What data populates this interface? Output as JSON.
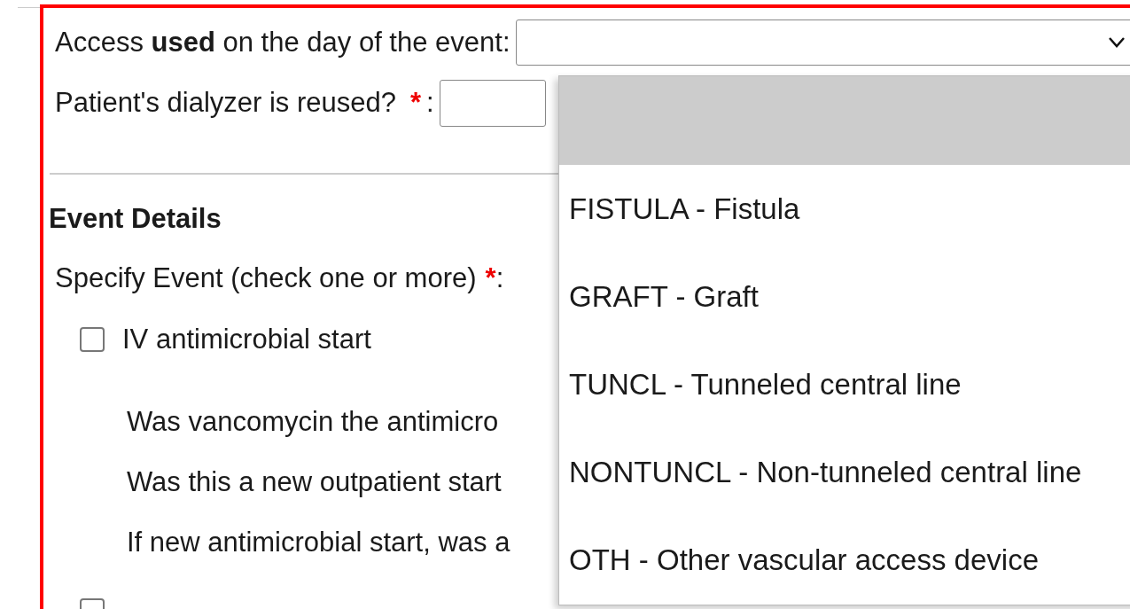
{
  "access_field": {
    "label": "Access **used** on the day of the event:",
    "open": true
  },
  "reuse_field": {
    "label": "Patient's dialyzer is reused?",
    "required_mark": "*",
    "colon": ":"
  },
  "section": {
    "title": "Event Details"
  },
  "specify": {
    "label": "Specify Event (check one or more)",
    "required_mark": "*",
    "colon": ":"
  },
  "events": [
    {
      "label": "IV antimicrobial start",
      "checked": false,
      "questions": [
        "Was vancomycin the antimicro",
        "Was this a new outpatient start",
        "If new antimicrobial start, was a"
      ]
    },
    {
      "checked": false
    }
  ],
  "dropdown_options": [
    {
      "selected": true
    },
    {
      "label": "FISTULA - Fistula",
      "selected": false
    },
    {
      "label": "GRAFT - Graft",
      "selected": false
    },
    {
      "label": "TUNCL - Tunneled central line",
      "selected": false
    },
    {
      "label": "NONTUNCL - Non-tunneled central line",
      "selected": false
    },
    {
      "label": "OTH - Other vascular access device",
      "selected": false
    }
  ]
}
